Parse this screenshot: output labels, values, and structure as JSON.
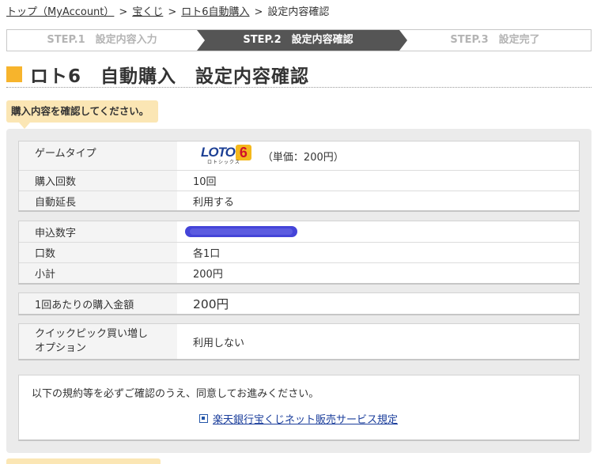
{
  "breadcrumb": {
    "home": "トップ（MyAccount）",
    "sep": ">",
    "takarakuji": "宝くじ",
    "loto6_auto": "ロト6自動購入",
    "current": "設定内容確認"
  },
  "steps": {
    "step1": "STEP.1　設定内容入力",
    "step2": "STEP.2　設定内容確認",
    "step3": "STEP.3　設定完了",
    "active": 2
  },
  "page_title": "ロト6　自動購入　設定内容確認",
  "notice": "購入内容を確認してください。",
  "rows": {
    "game_type": {
      "label": "ゲームタイプ",
      "unit_price": "（単価：200円）"
    },
    "purchase_count": {
      "label": "購入回数",
      "value": "10回"
    },
    "auto_extension": {
      "label": "自動延長",
      "value": "利用する"
    },
    "numbers": {
      "label": "申込数字"
    },
    "units": {
      "label": "口数",
      "value": "各1口"
    },
    "subtotal": {
      "label": "小計",
      "value": "200円"
    },
    "per_draw_amount": {
      "label": "1回あたりの購入金額",
      "value": "200円"
    },
    "quickpick_label_line1": "クイックピック買い増し",
    "quickpick_label_line2": "オプション",
    "quickpick_value": "利用しない"
  },
  "logo": {
    "text": "LOTO",
    "six": "6",
    "sub": "ロトシックス"
  },
  "terms": {
    "text": "以下の規約等を必ずご確認のうえ、同意してお進みください。",
    "link": "楽天銀行宝くじネット販売サービス規定"
  },
  "colors": {
    "accent": "#f7b42c",
    "active_step": "#555555",
    "notice_bg": "#fbe6b4",
    "link": "#1a3d9b",
    "mask": "#4444d8"
  },
  "icons": {
    "title_marker": "square-marker-icon",
    "external_link": "external-link-icon"
  }
}
